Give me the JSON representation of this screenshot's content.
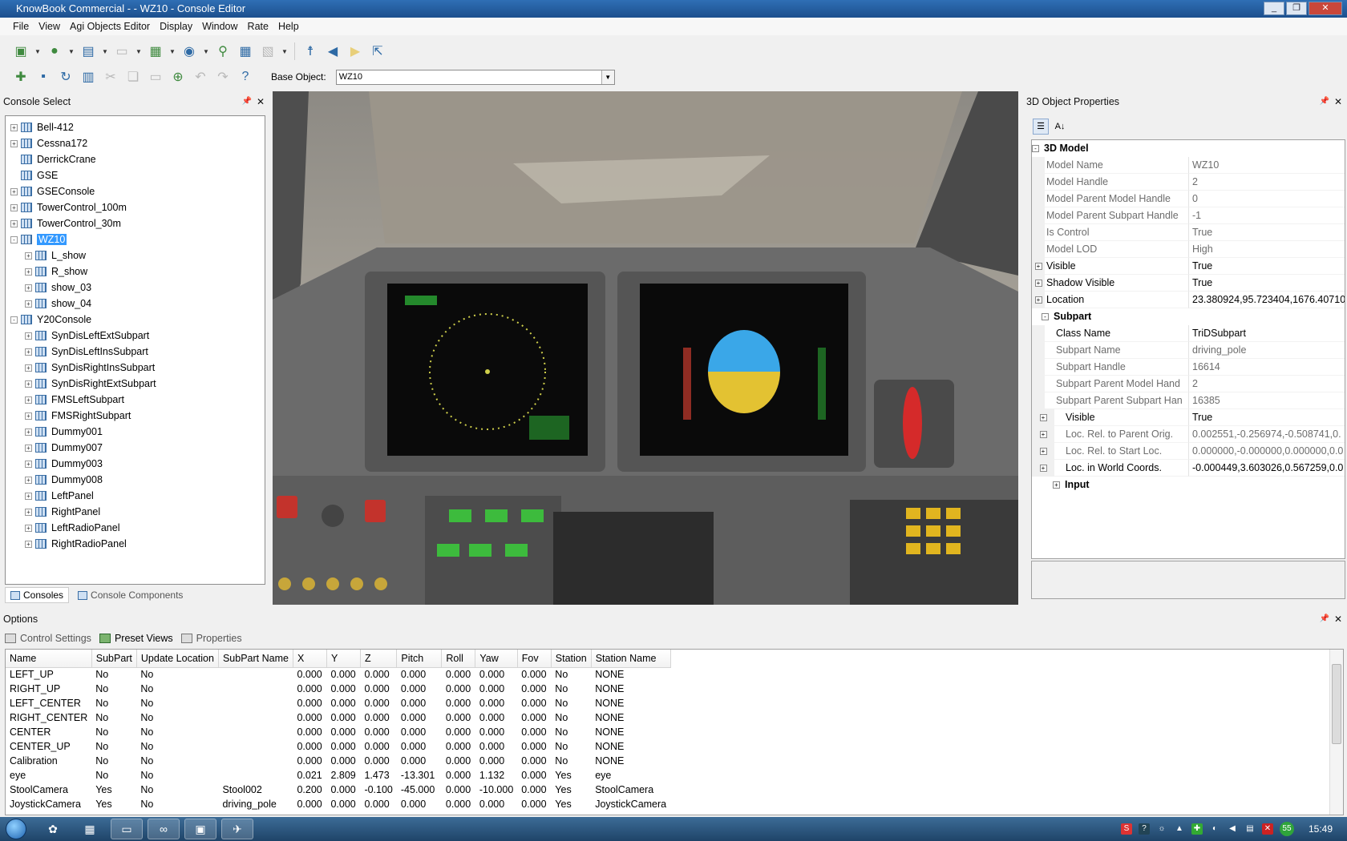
{
  "window": {
    "title": "KnowBook Commercial -  - WZ10 - Console Editor"
  },
  "menu": [
    "File",
    "View",
    "Agi Objects Editor",
    "Display",
    "Window",
    "Rate",
    "Help"
  ],
  "toolbar2": {
    "base_object_label": "Base Object:",
    "base_object_value": "WZ10"
  },
  "console_select": {
    "title": "Console Select",
    "tree": [
      {
        "label": "Bell-412",
        "level": 0,
        "expander": "+"
      },
      {
        "label": "Cessna172",
        "level": 0,
        "expander": "+"
      },
      {
        "label": "DerrickCrane",
        "level": 0,
        "expander": ""
      },
      {
        "label": "GSE",
        "level": 0,
        "expander": ""
      },
      {
        "label": "GSEConsole",
        "level": 0,
        "expander": "+"
      },
      {
        "label": "TowerControl_100m",
        "level": 0,
        "expander": "+"
      },
      {
        "label": "TowerControl_30m",
        "level": 0,
        "expander": "+"
      },
      {
        "label": "WZ10",
        "level": 0,
        "expander": "-",
        "selected": true
      },
      {
        "label": "L_show",
        "level": 1,
        "expander": "+"
      },
      {
        "label": "R_show",
        "level": 1,
        "expander": "+"
      },
      {
        "label": "show_03",
        "level": 1,
        "expander": "+"
      },
      {
        "label": "show_04",
        "level": 1,
        "expander": "+"
      },
      {
        "label": "Y20Console",
        "level": 0,
        "expander": "-"
      },
      {
        "label": "SynDisLeftExtSubpart",
        "level": 1,
        "expander": "+"
      },
      {
        "label": "SynDisLeftInsSubpart",
        "level": 1,
        "expander": "+"
      },
      {
        "label": "SynDisRightInsSubpart",
        "level": 1,
        "expander": "+"
      },
      {
        "label": "SynDisRightExtSubpart",
        "level": 1,
        "expander": "+"
      },
      {
        "label": "FMSLeftSubpart",
        "level": 1,
        "expander": "+"
      },
      {
        "label": "FMSRightSubpart",
        "level": 1,
        "expander": "+"
      },
      {
        "label": "Dummy001",
        "level": 1,
        "expander": "+"
      },
      {
        "label": "Dummy007",
        "level": 1,
        "expander": "+"
      },
      {
        "label": "Dummy003",
        "level": 1,
        "expander": "+"
      },
      {
        "label": "Dummy008",
        "level": 1,
        "expander": "+"
      },
      {
        "label": "LeftPanel",
        "level": 1,
        "expander": "+"
      },
      {
        "label": "RightPanel",
        "level": 1,
        "expander": "+"
      },
      {
        "label": "LeftRadioPanel",
        "level": 1,
        "expander": "+"
      },
      {
        "label": "RightRadioPanel",
        "level": 1,
        "expander": "+"
      }
    ],
    "tabs": {
      "consoles": "Consoles",
      "components": "Console Components"
    }
  },
  "properties": {
    "title": "3D Object Properties",
    "rows": [
      {
        "type": "cat",
        "name": "3D Model",
        "exp": "-"
      },
      {
        "name": "Model Name",
        "value": "WZ10",
        "dark": false
      },
      {
        "name": "Model Handle",
        "value": "2",
        "dark": false
      },
      {
        "name": "Model Parent Model Handle",
        "value": "0",
        "dark": false
      },
      {
        "name": "Model Parent Subpart Handle",
        "value": "-1",
        "dark": false
      },
      {
        "name": "Is Control",
        "value": "True",
        "dark": false
      },
      {
        "name": "Model LOD",
        "value": "High",
        "dark": false
      },
      {
        "name": "Visible",
        "value": "True",
        "dark": true,
        "exp": "+"
      },
      {
        "name": "Shadow Visible",
        "value": "True",
        "dark": true,
        "exp": "+"
      },
      {
        "name": "Location",
        "value": "23.380924,95.723404,1676.40710",
        "dark": true,
        "exp": "+"
      },
      {
        "type": "subcat",
        "name": "Subpart",
        "exp": "-"
      },
      {
        "name": "Class Name",
        "value": "TriDSubpart",
        "dark": true,
        "indent": 1
      },
      {
        "name": "Subpart Name",
        "value": "driving_pole",
        "dark": false,
        "indent": 1
      },
      {
        "name": "Subpart Handle",
        "value": "16614",
        "dark": false,
        "indent": 1
      },
      {
        "name": "Subpart Parent Model Hand",
        "value": "2",
        "dark": false,
        "indent": 1
      },
      {
        "name": "Subpart Parent Subpart Han",
        "value": "16385",
        "dark": false,
        "indent": 1
      },
      {
        "name": "Visible",
        "value": "True",
        "dark": true,
        "exp": "+",
        "indent": 1
      },
      {
        "name": "Loc. Rel. to Parent Orig.",
        "value": "0.002551,-0.256974,-0.508741,0.",
        "dark": false,
        "exp": "+",
        "indent": 1
      },
      {
        "name": "Loc. Rel. to Start Loc.",
        "value": "0.000000,-0.000000,0.000000,0.0",
        "dark": false,
        "exp": "+",
        "indent": 1
      },
      {
        "name": "Loc. in World Coords.",
        "value": "-0.000449,3.603026,0.567259,0.0",
        "dark": true,
        "exp": "+",
        "indent": 1
      },
      {
        "type": "subcat2",
        "name": "Input",
        "exp": "+"
      }
    ]
  },
  "options": {
    "title": "Options",
    "tabs": {
      "control": "Control Settings",
      "preset": "Preset Views",
      "props": "Properties"
    },
    "columns": [
      "Name",
      "SubPart",
      "Update Location",
      "SubPart Name",
      "X",
      "Y",
      "Z",
      "Pitch",
      "Roll",
      "Yaw",
      "Fov",
      "Station",
      "Station Name"
    ],
    "rows": [
      [
        "LEFT_UP",
        "No",
        "No",
        "",
        "0.000",
        "0.000",
        "0.000",
        "0.000",
        "0.000",
        "0.000",
        "0.000",
        "No",
        "NONE"
      ],
      [
        "RIGHT_UP",
        "No",
        "No",
        "",
        "0.000",
        "0.000",
        "0.000",
        "0.000",
        "0.000",
        "0.000",
        "0.000",
        "No",
        "NONE"
      ],
      [
        "LEFT_CENTER",
        "No",
        "No",
        "",
        "0.000",
        "0.000",
        "0.000",
        "0.000",
        "0.000",
        "0.000",
        "0.000",
        "No",
        "NONE"
      ],
      [
        "RIGHT_CENTER",
        "No",
        "No",
        "",
        "0.000",
        "0.000",
        "0.000",
        "0.000",
        "0.000",
        "0.000",
        "0.000",
        "No",
        "NONE"
      ],
      [
        "CENTER",
        "No",
        "No",
        "",
        "0.000",
        "0.000",
        "0.000",
        "0.000",
        "0.000",
        "0.000",
        "0.000",
        "No",
        "NONE"
      ],
      [
        "CENTER_UP",
        "No",
        "No",
        "",
        "0.000",
        "0.000",
        "0.000",
        "0.000",
        "0.000",
        "0.000",
        "0.000",
        "No",
        "NONE"
      ],
      [
        "Calibration",
        "No",
        "No",
        "",
        "0.000",
        "0.000",
        "0.000",
        "0.000",
        "0.000",
        "0.000",
        "0.000",
        "No",
        "NONE"
      ],
      [
        "eye",
        "No",
        "No",
        "",
        "0.021",
        "2.809",
        "1.473",
        "-13.301",
        "0.000",
        "1.132",
        "0.000",
        "Yes",
        "eye"
      ],
      [
        "StoolCamera",
        "Yes",
        "No",
        "Stool002",
        "0.200",
        "0.000",
        "-0.100",
        "-45.000",
        "0.000",
        "-10.000",
        "0.000",
        "Yes",
        "StoolCamera"
      ],
      [
        "JoystickCamera",
        "Yes",
        "No",
        "driving_pole",
        "0.000",
        "0.000",
        "0.000",
        "0.000",
        "0.000",
        "0.000",
        "0.000",
        "Yes",
        "JoystickCamera"
      ]
    ]
  },
  "taskbar": {
    "clock": "15:49",
    "badge": "55"
  }
}
